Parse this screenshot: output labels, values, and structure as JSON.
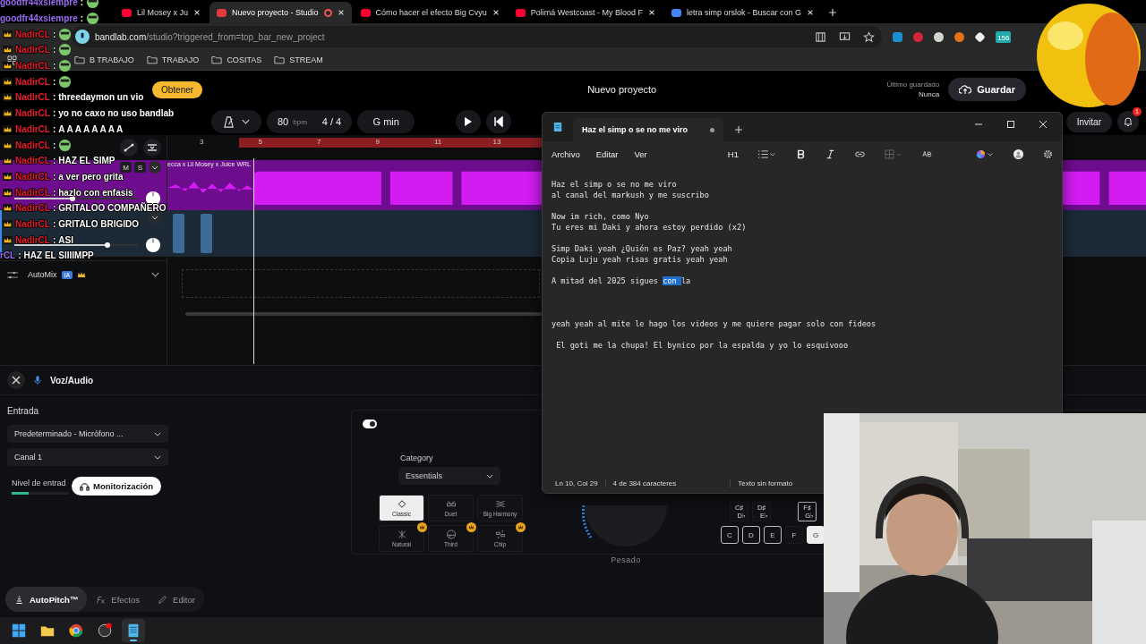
{
  "browser": {
    "tabs": [
      {
        "title": "Lil Mosey x Ju",
        "kind": "video",
        "selected": false
      },
      {
        "title": "Nuevo proyecto - Studio",
        "kind": "studio",
        "selected": true
      },
      {
        "title": "Cómo hacer el efecto Big Cvyu",
        "kind": "video",
        "selected": false
      },
      {
        "title": "Polimá Westcoast - My Blood F",
        "kind": "video",
        "selected": false
      },
      {
        "title": "letra simp orslok - Buscar con G",
        "kind": "search",
        "selected": false
      }
    ],
    "url_host": "bandlab.com",
    "url_path": "/studio?triggered_from=top_bar_new_project",
    "bookmarks": [
      "B TRABAJO",
      "TRABAJO",
      "COSITAS",
      "STREAM"
    ],
    "extension_badge": "156"
  },
  "studio": {
    "get_button": "Obtener",
    "project_title": "Nuevo proyecto",
    "last_saved_label": "Último guardado",
    "last_saved": "Nunca",
    "save_button": "Guardar",
    "tempo": "80",
    "tempo_unit": "bpm",
    "time_signature": "4 / 4",
    "key": "G min",
    "invite_button": "Invitar",
    "notifications": "1",
    "ruler": [
      "3",
      "5",
      "7",
      "9",
      "11",
      "13"
    ],
    "tracks": [
      {
        "kind": "music",
        "mute": "M",
        "solo": "S",
        "clip": "ecca x Lil Mosey x Juice WRL",
        "level": 0.47
      },
      {
        "kind": "voice",
        "level": 0.75
      }
    ],
    "automix": {
      "label": "AutoMix",
      "badge": "IA"
    }
  },
  "voice_panel": {
    "title": "Voz/Audio",
    "input_label": "Entrada",
    "input_device": "Predeterminado - Micrófono ...",
    "channel": "Canal 1",
    "level_label": "Nivel de entrad",
    "level": 0.3,
    "monitor_button": "Monitorización",
    "effect_on": true,
    "category_label": "Category",
    "category": "Essentials",
    "presets": [
      {
        "label": "Classic",
        "kind": "classic",
        "selected": true,
        "premium": false
      },
      {
        "label": "Duet",
        "kind": "duet",
        "selected": false,
        "premium": false
      },
      {
        "label": "Big Harmony",
        "kind": "harmony",
        "selected": false,
        "premium": false
      },
      {
        "label": "Natural",
        "kind": "natural",
        "selected": false,
        "premium": true
      },
      {
        "label": "Third",
        "kind": "third",
        "selected": false,
        "premium": true
      },
      {
        "label": "Chip",
        "kind": "chip",
        "selected": false,
        "premium": true
      }
    ],
    "knob_label": "Pesado",
    "sharp_keys": [
      {
        "top": "C♯",
        "bottom": "D♭",
        "in_scale": false
      },
      {
        "top": "D♯",
        "bottom": "E♭",
        "in_scale": false
      },
      {
        "top": "F♯",
        "bottom": "G♭",
        "in_scale": true
      }
    ],
    "keys": [
      {
        "label": "C",
        "in_scale": true,
        "selected": false
      },
      {
        "label": "D",
        "in_scale": true,
        "selected": false
      },
      {
        "label": "E",
        "in_scale": true,
        "selected": false
      },
      {
        "label": "F",
        "in_scale": false,
        "selected": false
      },
      {
        "label": "G",
        "in_scale": true,
        "selected": true
      }
    ],
    "tabs": [
      {
        "label": "AutoPitch™",
        "kind": "autopitch",
        "selected": true
      },
      {
        "label": "Efectos",
        "kind": "fx",
        "selected": false
      },
      {
        "label": "Editor",
        "kind": "editor",
        "selected": false
      }
    ]
  },
  "notepad": {
    "tab_title": "Haz el simp o se no me viro",
    "unsaved": true,
    "menu": [
      "Archivo",
      "Editar",
      "Ver"
    ],
    "heading_button": "H1",
    "stanzas": [
      [
        {
          "text": "Haz el simp o se no me viro"
        },
        {
          "text": "al canal del markush y me suscribo"
        }
      ],
      [
        {
          "text": "Now im rich, como Nyo"
        },
        {
          "text": "Tu eres mi Daki y ahora estoy perdido (x2)"
        }
      ],
      [
        {
          "text": "Simp Daki yeah ¿Quién es Paz? yeah yeah"
        },
        {
          "text": "Copia Luju yeah risas gratis yeah yeah"
        }
      ],
      [
        {
          "text": "A mitad del 2025 sigues ",
          "selection": "con ",
          "after": "la"
        }
      ],
      [
        {
          "text": "yeah yeah al mite le hago los videos y me quiere pagar solo con fideos"
        }
      ],
      [
        {
          "text": " El goti me la chupa! El bynico por la espalda y yo lo esquivooo"
        }
      ]
    ],
    "position": "Ln 10, Col 29",
    "count": "4 de 384 caracteres",
    "format": "Texto sin formato"
  },
  "chat": [
    {
      "user": "goodfr44xsiempre",
      "sep": ":",
      "crown": false,
      "kind": "emote"
    },
    {
      "user": "goodfr44xsiempre",
      "sep": ":",
      "crown": false,
      "kind": "emote"
    },
    {
      "user": "NadirCL",
      "sep": ":",
      "crown": true,
      "kind": "emote"
    },
    {
      "user": "NadirCL",
      "sep": ":",
      "crown": true,
      "kind": "emote"
    },
    {
      "user": "NadirCL",
      "sep": ":",
      "crown": true,
      "kind": "emote"
    },
    {
      "user": "NadirCL",
      "sep": ":",
      "crown": true,
      "kind": "emote"
    },
    {
      "user": "NadirCL",
      "sep": ":",
      "crown": true,
      "kind": "text",
      "message": "threedaymon un vio"
    },
    {
      "user": "NadirCL",
      "sep": ":",
      "crown": true,
      "kind": "text",
      "message": "yo no caxo no uso bandlab"
    },
    {
      "user": "NadirCL",
      "sep": ":",
      "crown": true,
      "kind": "text",
      "message": "A A A A A A A A"
    },
    {
      "user": "NadirCL",
      "sep": ":",
      "crown": true,
      "kind": "emote"
    },
    {
      "user": "NadirCL",
      "sep": ":",
      "crown": true,
      "kind": "text",
      "message": "HAZ EL SIMP"
    },
    {
      "user": "NadirCL",
      "sep": ":",
      "crown": true,
      "kind": "text",
      "message": "a ver pero grita"
    },
    {
      "user": "NadirCL",
      "sep": ":",
      "crown": true,
      "kind": "text",
      "message": "hazlo con enfasis"
    },
    {
      "user": "NadirCL",
      "sep": ":",
      "crown": true,
      "kind": "text",
      "message": "GRITALOO COMPAÑERO"
    },
    {
      "user": "NadirCL",
      "sep": ":",
      "crown": true,
      "kind": "text",
      "message": "GRITALO BRIGIDO"
    },
    {
      "user": "NadirCL",
      "sep": ":",
      "crown": true,
      "kind": "text",
      "message": "ASI"
    },
    {
      "user": "rCL",
      "sep": ":",
      "crown": false,
      "kind": "text",
      "message": "HAZ EL SIIIIMPP"
    }
  ],
  "taskbar": [
    {
      "kind": "start",
      "active": false
    },
    {
      "kind": "folder",
      "active": false
    },
    {
      "kind": "browser",
      "active": false
    },
    {
      "kind": "recorder",
      "active": false
    },
    {
      "kind": "notepad",
      "active": true
    }
  ]
}
